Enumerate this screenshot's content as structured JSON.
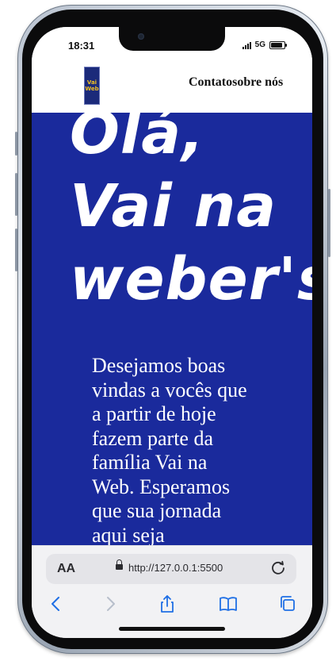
{
  "status_bar": {
    "time": "18:31",
    "network": "5G"
  },
  "header": {
    "logo_line1": "Vai",
    "logo_line2": "Web",
    "nav": [
      "Contato",
      "sobre nós"
    ]
  },
  "hero": {
    "lines": [
      "Olá,",
      "Vai na",
      "weber's"
    ],
    "text_color": "#ffffff",
    "background": "#1a2a9c"
  },
  "welcome_text": "Desejamos boas vindas a vocês que a partir de hoje fazem parte da família Vai na Web. Esperamos que sua jornada aqui seja",
  "browser": {
    "reader_label": "AA",
    "url": "http://127.0.0.1:5500",
    "toolbar_icons": [
      "back-icon",
      "forward-icon",
      "share-icon",
      "bookmarks-icon",
      "tabs-icon"
    ]
  }
}
